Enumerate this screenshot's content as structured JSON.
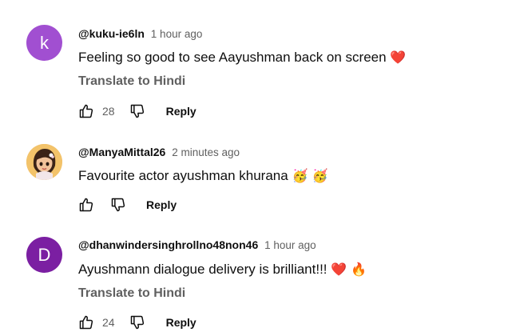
{
  "comments": [
    {
      "avatar_letter": "k",
      "avatar_color": "#a14fd1",
      "author": "@kuku-ie6ln",
      "time": "1 hour ago",
      "text": "Feeling so good to see Aayushman back on screen",
      "emoji": "❤️",
      "translate": "Translate to Hindi",
      "likes": "28",
      "reply": "Reply"
    },
    {
      "avatar_letter": "",
      "avatar_color": "#e9b45a",
      "author": "@ManyaMittal26",
      "time": "2 minutes ago",
      "text": "Favourite actor ayushman khurana",
      "emoji": "🥳 🥳",
      "likes": "",
      "reply": "Reply"
    },
    {
      "avatar_letter": "D",
      "avatar_color": "#7b1fa2",
      "author": "@dhanwindersinghrollno48non46",
      "time": "1 hour ago",
      "text": "Ayushmann dialogue delivery is brilliant!!!",
      "emoji": "❤️ 🔥",
      "translate": "Translate to Hindi",
      "likes": "24",
      "reply": "Reply"
    }
  ]
}
